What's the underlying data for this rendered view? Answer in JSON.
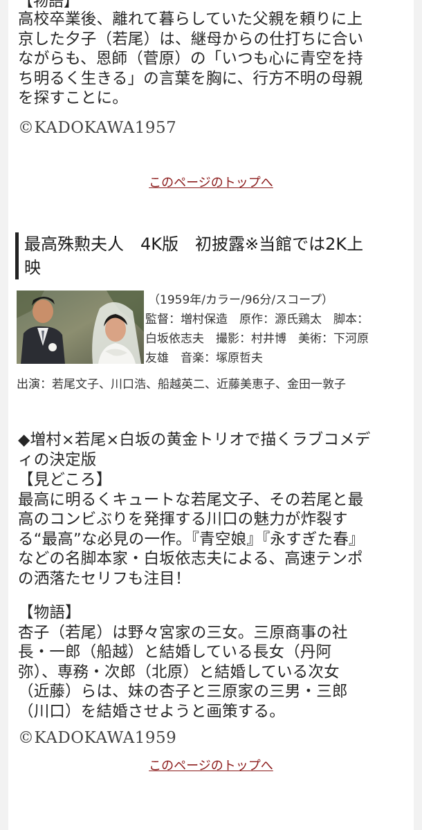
{
  "prev_film": {
    "section_label": "【物語】",
    "synopsis_lines": [
      "高校卒業後、離れて暮らしていた父親を頼りに上",
      "京した夕子（若尾）は、継母からの仕打ちに合い",
      "ながらも、恩師（菅原）の「いつも心に青空を持",
      "ち明るく生きる」の言葉を胸に、行方不明の母親",
      "を探すことに。"
    ],
    "copyright": "©KADOKAWA1957"
  },
  "top_link_label": "このページのトップへ",
  "film": {
    "title_lines": [
      "最高殊勲夫人　4K版　初披露※当館では2K上",
      "映"
    ],
    "image_name": "wedding-still-image",
    "info_lines": [
      "（1959年/カラー/96分/スコープ）",
      "監督：増村保造　原作：源氏鶏太　脚本：",
      "白坂依志夫　撮影：村井博　美術：下河原",
      "友雄　音楽：塚原哲夫"
    ],
    "cast": "出演：若尾文子、川口浩、船越英二、近藤美恵子、金田一敦子",
    "tagline_lines": [
      "◆増村×若尾×白坂の黄金トリオで描くラブコメデ",
      "ィの決定版"
    ],
    "highlights_label": "【見どころ】",
    "highlights_lines": [
      "最高に明るくキュートな若尾文子、その若尾と最",
      "高のコンビぶりを発揮する川口の魅力が炸裂す",
      "る“最高”な必見の一作。『青空娘』『永すぎた春』",
      "などの名脚本家・白坂依志夫による、高速テンポ",
      "の洒落たセリフも注目！"
    ],
    "story_label": "【物語】",
    "story_lines": [
      "杏子（若尾）は野々宮家の三女。三原商事の社",
      "長・一郎（船越）と結婚している長女（丹阿",
      "弥）、専務・次郎（北原）と結婚している次女",
      "（近藤）らは、妹の杏子と三原家の三男・三郎",
      "（川口）を結婚させようと画策する。"
    ],
    "copyright": "©KADOKAWA1959"
  },
  "colors": {
    "link": "#8b1a1a",
    "text": "#262626",
    "title_bar": "#222222"
  }
}
